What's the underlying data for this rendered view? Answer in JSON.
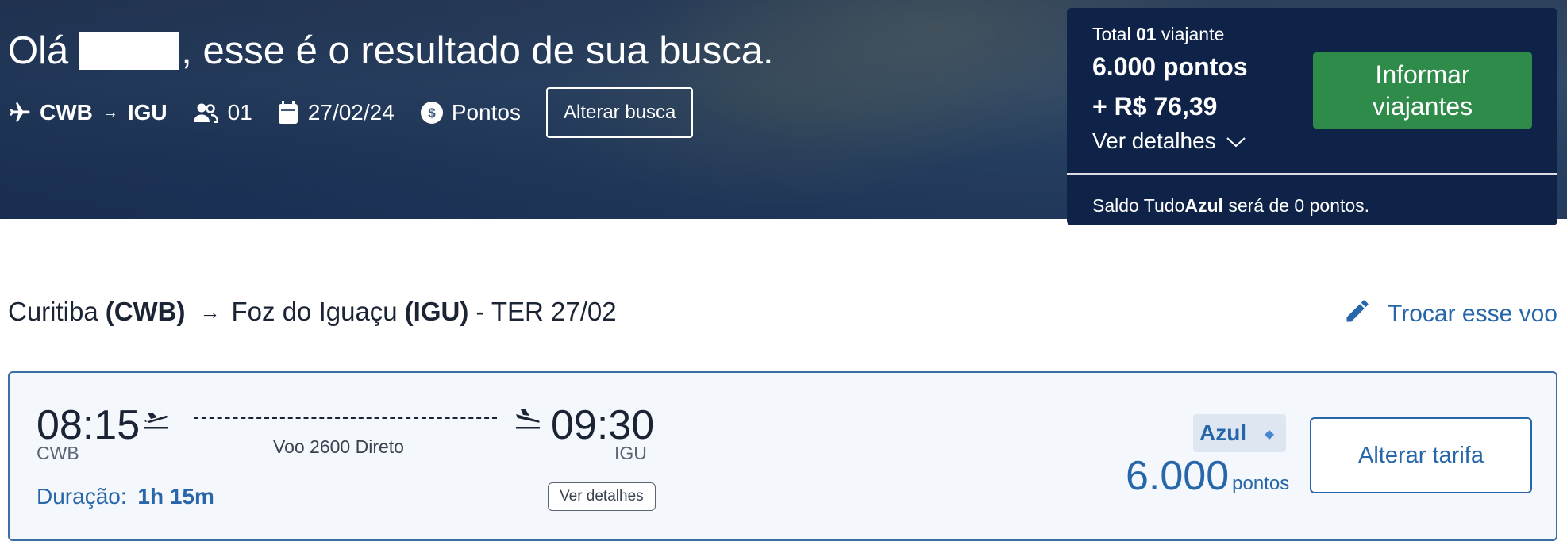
{
  "header": {
    "greeting_prefix": "Olá",
    "greeting_suffix": ", esse é o resultado de sua busca.",
    "origin_code": "CWB",
    "destination_code": "IGU",
    "passengers": "01",
    "date": "27/02/24",
    "payment_mode": "Pontos",
    "alterar_busca_label": "Alterar busca"
  },
  "summary": {
    "total_prefix": "Total",
    "total_count": "01",
    "total_suffix": "viajante",
    "points_total": "6.000 pontos",
    "money_total": "+ R$ 76,39",
    "ver_detalhes_label": "Ver detalhes",
    "informar_label": "Informar viajantes",
    "saldo_prefix": "Saldo Tudo",
    "saldo_brand": "Azul",
    "saldo_suffix": " será de 0 pontos."
  },
  "route": {
    "origin_city": "Curitiba",
    "origin_code": "(CWB)",
    "destination_city": "Foz do Iguaçu",
    "destination_code": "(IGU)",
    "date_label": "- TER 27/02",
    "trocar_label": "Trocar esse voo"
  },
  "flight": {
    "departure_time": "08:15",
    "departure_code": "CWB",
    "arrival_time": "09:30",
    "arrival_code": "IGU",
    "flight_info": "Voo 2600 Direto",
    "duration_label": "Duração:",
    "duration_value": "1h 15m",
    "ver_detalhes_label": "Ver detalhes",
    "fare_badge": "Azul",
    "price_points": "6.000",
    "price_unit": "pontos",
    "alterar_tarifa_label": "Alterar tarifa"
  },
  "colors": {
    "navy": "#0e2347",
    "green_button": "#2e8b4a",
    "accent_blue": "#2766a8"
  },
  "icons": [
    "airplane-icon",
    "users-icon",
    "calendar-icon",
    "dollar-circle-icon",
    "chevron-down-icon",
    "pencil-icon",
    "takeoff-icon",
    "landing-icon",
    "diamond-icon"
  ]
}
